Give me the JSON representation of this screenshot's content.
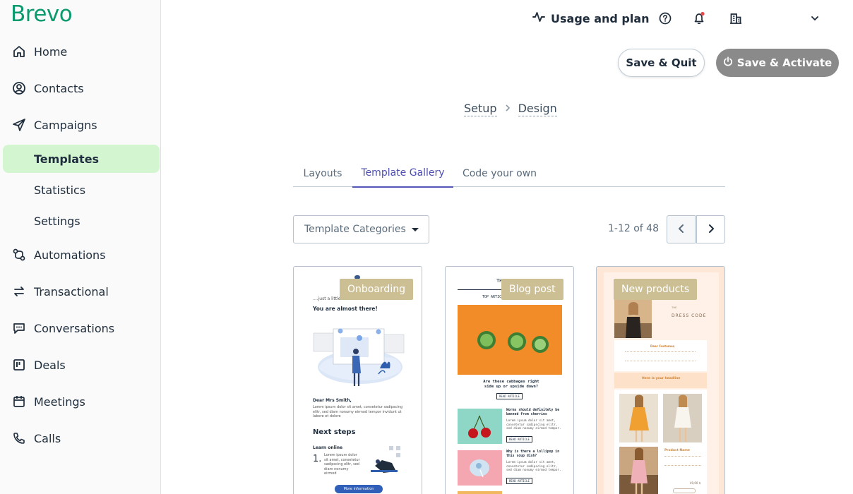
{
  "brand": {
    "logo_text": "Brevo",
    "logo_color": "#0b996e",
    "accent": "#5455b8"
  },
  "sidebar": {
    "items": [
      {
        "label": "Home",
        "icon": "home-icon"
      },
      {
        "label": "Contacts",
        "icon": "contacts-icon"
      },
      {
        "label": "Campaigns",
        "icon": "paper-plane-icon"
      },
      {
        "label": "Templates"
      },
      {
        "label": "Statistics"
      },
      {
        "label": "Settings"
      },
      {
        "label": "Automations",
        "icon": "automation-icon"
      },
      {
        "label": "Transactional",
        "icon": "arrows-swap-icon"
      },
      {
        "label": "Conversations",
        "icon": "chat-icon"
      },
      {
        "label": "Deals",
        "icon": "board-icon"
      },
      {
        "label": "Meetings",
        "icon": "calendar-icon"
      },
      {
        "label": "Calls",
        "icon": "phone-icon"
      }
    ],
    "active": "Templates"
  },
  "header": {
    "usage_label": "Usage and plan"
  },
  "actions": {
    "save_quit": "Save & Quit",
    "save_activate": "Save & Activate"
  },
  "breadcrumb": {
    "step1": "Setup",
    "step2": "Design"
  },
  "tabs": [
    {
      "label": "Layouts"
    },
    {
      "label": "Template Gallery"
    },
    {
      "label": "Code your own"
    }
  ],
  "filter": {
    "dropdown_label": "Template Categories"
  },
  "pager": {
    "range": "1-12 of 48"
  },
  "cards": [
    {
      "badge": "Onboarding",
      "preview": {
        "tagline": "....just a little bit more",
        "heading": "You are almost there!",
        "greeting": "Dear Mrs Smith,",
        "body": "Lorem ipsum dolor sit amet, consetetur sadipscing elitr, sed diam nonumy eirmod tempor invidunt ut labore et dolore",
        "steps_title": "Next steps",
        "step_label": "Learn online",
        "step_num": "1.",
        "step_text": "Lorem ipsum dolor sit amet, consetetur sadipscing elitr, sed diam nonumy eirmod",
        "cta": "More information"
      }
    },
    {
      "badge": "Blog post",
      "preview": {
        "top_article": "TOP ARTICLE",
        "headline": "Are these cabbages right side up or upside down?",
        "read": "READ ARTICLE",
        "item1": "Worms should definitely be banned from cherries",
        "item2": "Why is there a lollipop in this soup dish?",
        "lorem": "Lorem ipsum dolor sit amet, consetetur sadipscing elitr, sed diam nonumy eirmod tempor."
      }
    },
    {
      "badge": "New products",
      "preview": {
        "dress_code": "DRESS CODE",
        "greeting": "Dear Customer,",
        "headline": "Here is your headline",
        "product": "Product Name",
        "price": "49,00 $"
      }
    }
  ]
}
